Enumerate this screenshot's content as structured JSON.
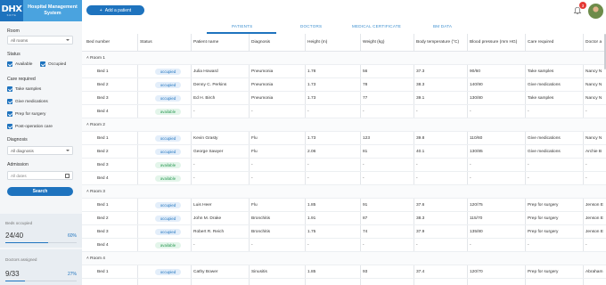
{
  "app": {
    "logo_text": "DHX",
    "logo_sub": "SUITE",
    "title_line1": "Hospital Management",
    "title_line2": "System",
    "add_patient_label": "Add a patient",
    "notification_count": "3"
  },
  "tabs": [
    {
      "label": "PATIENTS",
      "active": true
    },
    {
      "label": "DOCTORS",
      "active": false
    },
    {
      "label": "MEDICAL CERTIFICATE",
      "active": false
    },
    {
      "label": "BM DATA",
      "active": false
    }
  ],
  "sidebar": {
    "room_label": "Room",
    "room_value": "All rooms",
    "status_label": "Status",
    "status_available": "Available",
    "status_occupied": "Occupied",
    "care_label": "Care required",
    "care_options": [
      "Take samples",
      "Give medications",
      "Prep for surgery",
      "Post-operation care"
    ],
    "diagnosis_label": "Diagnosis",
    "diagnosis_value": "All diagnosis",
    "admission_label": "Admission",
    "admission_placeholder": "All dates",
    "search_label": "Search"
  },
  "stats": {
    "beds_title": "Beds occupied",
    "beds_value": "24/40",
    "beds_pct": "60%",
    "beds_fraction": 0.6,
    "doctors_title": "Doctors assigned",
    "doctors_value": "9/33",
    "doctors_pct": "27%",
    "doctors_fraction": 0.27
  },
  "table": {
    "headers": [
      "Bed number",
      "Status",
      "Patient name",
      "Diagnosis",
      "Height (m)",
      "Weight (kg)",
      "Body temperature (°C)",
      "Blood pressure (mm HG)",
      "Care required",
      "Doctor a"
    ],
    "groups": [
      {
        "label": "Room 1",
        "rows": [
          [
            "Bed 1",
            "occupied",
            "Julia Howard",
            "Pneumonia",
            "1.78",
            "56",
            "37.3",
            "90/60",
            "Take samples",
            "Nancy N"
          ],
          [
            "Bed 2",
            "occupied",
            "Denny C. Perkins",
            "Pneumonia",
            "1.73",
            "78",
            "38.3",
            "140/90",
            "Give medications",
            "Nancy N"
          ],
          [
            "Bed 3",
            "occupied",
            "Ed H. Birch",
            "Pneumonia",
            "1.73",
            "77",
            "39.1",
            "130/80",
            "Take samples",
            "Nancy N"
          ],
          [
            "Bed 4",
            "available",
            "-",
            "-",
            "-",
            "-",
            "-",
            "-",
            "-",
            "-"
          ]
        ]
      },
      {
        "label": "Room 2",
        "rows": [
          [
            "Bed 1",
            "occupied",
            "Kevin Grasty",
            "Flu",
            "1.73",
            "123",
            "39.8",
            "110/60",
            "Give medications",
            "Nancy N"
          ],
          [
            "Bed 2",
            "occupied",
            "George Sawyer",
            "Flu",
            "2.06",
            "81",
            "40.1",
            "130/85",
            "Give medications",
            "Archie B"
          ],
          [
            "Bed 3",
            "available",
            "-",
            "-",
            "-",
            "-",
            "-",
            "-",
            "-",
            "-"
          ],
          [
            "Bed 4",
            "available",
            "-",
            "-",
            "-",
            "-",
            "-",
            "-",
            "-",
            "-"
          ]
        ]
      },
      {
        "label": "Room 3",
        "rows": [
          [
            "Bed 1",
            "occupied",
            "Luis Heer",
            "Flu",
            "1.85",
            "91",
            "37.6",
            "120/75",
            "Prep for surgery",
            "Jenson E"
          ],
          [
            "Bed 2",
            "occupied",
            "John M. Drake",
            "Bronchitis",
            "1.91",
            "87",
            "38.3",
            "115/70",
            "Prep for surgery",
            "Jenson E"
          ],
          [
            "Bed 3",
            "occupied",
            "Robert R. Reich",
            "Bronchitis",
            "1.75",
            "74",
            "37.9",
            "135/80",
            "Prep for surgery",
            "Jenson E"
          ],
          [
            "Bed 4",
            "available",
            "-",
            "-",
            "-",
            "-",
            "-",
            "-",
            "-",
            "-"
          ]
        ]
      },
      {
        "label": "Room 4",
        "rows": [
          [
            "Bed 1",
            "occupied",
            "Cathy Bower",
            "Sinusitis",
            "1.85",
            "93",
            "37.4",
            "120/70",
            "Prep for surgery",
            "Abraham"
          ]
        ]
      }
    ]
  }
}
